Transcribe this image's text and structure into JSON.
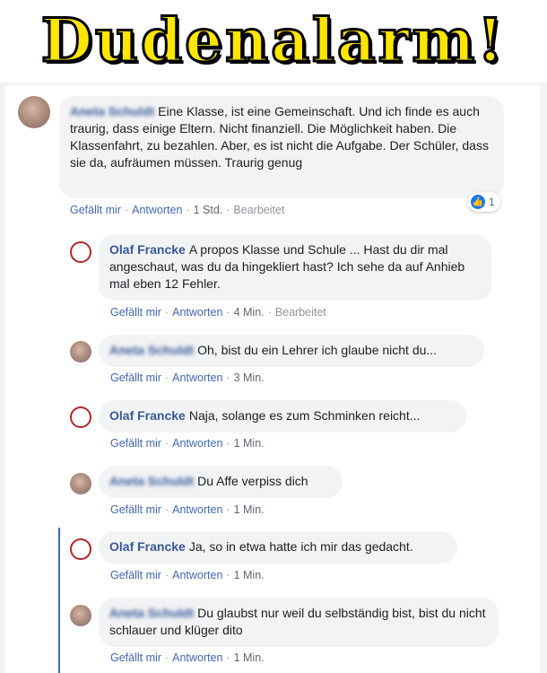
{
  "banner": {
    "title": "Dudenalarm!"
  },
  "comments": [
    {
      "author": "Aneta Schuldt",
      "text": "Eine Klasse, ist eine Gemeinschaft. Und ich finde es auch traurig, dass einige Eltern. Nicht finanziell. Die Möglichkeit haben. Die Klassenfahrt, zu bezahlen. Aber, es ist nicht die Aufgabe. Der Schüler, dass sie da, aufräumen müssen. Traurig genug",
      "like": "Gefällt mir",
      "reply": "Antworten",
      "time": "1 Std.",
      "edited": "Bearbeitet",
      "reactions": "1"
    },
    {
      "author": "Olaf Francke",
      "text": "A propos Klasse und Schule ... Hast du dir mal angeschaut, was du da hingekliert hast? Ich sehe da auf Anhieb mal eben 12 Fehler.",
      "like": "Gefällt mir",
      "reply": "Antworten",
      "time": "4 Min.",
      "edited": "Bearbeitet"
    },
    {
      "author": "Aneta Schuldt",
      "text": "Oh, bist du ein Lehrer ich glaube nicht du...",
      "like": "Gefällt mir",
      "reply": "Antworten",
      "time": "3 Min."
    },
    {
      "author": "Olaf Francke",
      "text": "Naja, solange es zum Schminken reicht...",
      "like": "Gefällt mir",
      "reply": "Antworten",
      "time": "1 Min."
    },
    {
      "author": "Aneta Schuldt",
      "text": "Du Affe verpiss dich",
      "like": "Gefällt mir",
      "reply": "Antworten",
      "time": "1 Min."
    },
    {
      "author": "Olaf Francke",
      "text": "Ja, so in etwa hatte ich mir das gedacht.",
      "like": "Gefällt mir",
      "reply": "Antworten",
      "time": "1 Min."
    },
    {
      "author": "Aneta Schuldt",
      "text": "Du glaubst nur weil du selbständig bist, bist du nicht schlauer und klüger dito",
      "like": "Gefällt mir",
      "reply": "Antworten",
      "time": "1 Min."
    }
  ],
  "icons": {
    "like_reaction": "thumbs-up-icon",
    "author_logo": "eagle-logo-icon"
  },
  "colors": {
    "banner_fill": "#ffe600",
    "link": "#385898",
    "meta_link": "#4267b2",
    "bubble": "#f2f3f5"
  }
}
